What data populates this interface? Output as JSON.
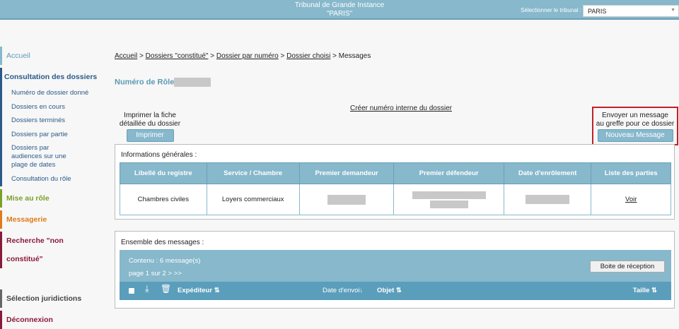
{
  "header": {
    "title_line1": "Tribunal de Grande Instance",
    "title_line2": "\"PARIS\"",
    "select_label": "Sélectionner le tribunal :",
    "select_value": "PARIS"
  },
  "sidebar": {
    "accueil": "Accueil",
    "consultation": "Consultation des dossiers",
    "sub": [
      "Numéro de dossier donné",
      "Dossiers en cours",
      "Dossiers terminés",
      "Dossiers par partie",
      "Dossiers par audiences sur une plage de dates",
      "Consultation du rôle"
    ],
    "mise": "Mise au rôle",
    "messagerie": "Messagerie",
    "recherche": "Recherche \"non constitué\"",
    "selection": "Sélection juridictions",
    "deconnexion": "Déconnexion"
  },
  "breadcrumb": {
    "items": [
      "Accueil",
      "Dossiers \"constitué\"",
      "Dossier par numéro",
      "Dossier choisi"
    ],
    "current": "Messages",
    "sep": ">"
  },
  "role_label": "Numéro de Rôle",
  "create_link": "Créer numéro interne du dossier",
  "print": {
    "text1": "Imprimer la fiche",
    "text2": "détaillée du dossier",
    "button": "Imprimer"
  },
  "send": {
    "text1": "Envoyer un message",
    "text2": "au greffe pour ce dossier",
    "button": "Nouveau Message"
  },
  "info": {
    "title": "Informations générales :",
    "headers": [
      "Libellé du registre",
      "Service / Chambre",
      "Premier demandeur",
      "Premier défendeur",
      "Date d'enrôlement",
      "Liste des parties"
    ],
    "row": {
      "registre": "Chambres civiles",
      "service": "Loyers commerciaux",
      "parties_link": "Voir"
    }
  },
  "messages": {
    "title": "Ensemble des messages :",
    "count": "Contenu : 6 message(s)",
    "page": "page 1 sur 2",
    "next": ">",
    "last": ">>",
    "inbox_button": "Boite de réception",
    "cols": {
      "sender": "Expéditeur",
      "date": "Date d'envoi",
      "object": "Objet",
      "size": "Taille"
    }
  },
  "colors": {
    "accent": "#87b8cc",
    "highlight": "#c0202a"
  }
}
